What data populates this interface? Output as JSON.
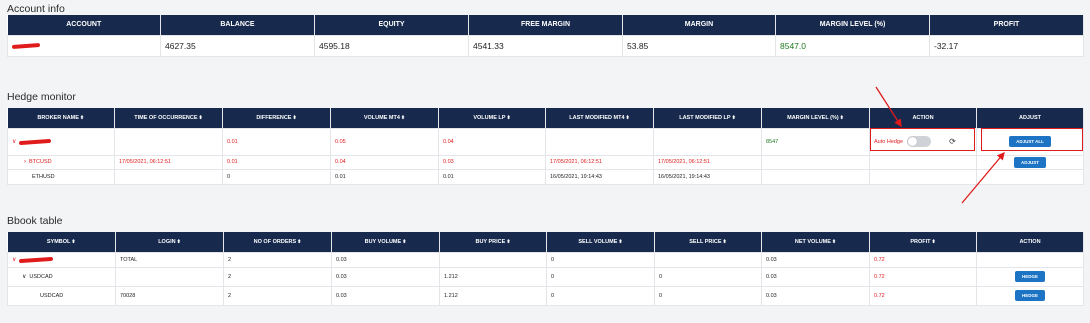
{
  "account": {
    "title": "Account info",
    "headers": [
      "ACCOUNT",
      "BALANCE",
      "EQUITY",
      "FREE MARGIN",
      "MARGIN",
      "MARGIN LEVEL (%)",
      "PROFIT"
    ],
    "row": {
      "balance": "4627.35",
      "equity": "4595.18",
      "free_margin": "4541.33",
      "margin": "53.85",
      "margin_level": "8547.0",
      "profit": "-32.17"
    }
  },
  "hedge": {
    "title": "Hedge monitor",
    "headers": [
      "BROKER NAME",
      "TIME OF OCCURRENCE",
      "DIFFERENCE",
      "VOLUME MT4",
      "VOLUME LP",
      "LAST MODIFIED MT4",
      "LAST MODIFIED LP",
      "MARGIN LEVEL (%)",
      "ACTION",
      "ADJUST"
    ],
    "rows": [
      {
        "name": "",
        "time": "",
        "difference": "0.01",
        "vol_mt4": "0.05",
        "vol_lp": "0.04",
        "mod_mt4": "",
        "mod_lp": "",
        "margin_level": "8547",
        "auto_hedge": "Auto Hedge",
        "adjust": "ADJUST ALL"
      },
      {
        "name": "BTCUSD",
        "time": "17/05/2021, 06:12:51",
        "difference": "0.01",
        "vol_mt4": "0.04",
        "vol_lp": "0.03",
        "mod_mt4": "17/05/2021, 06:12:51",
        "mod_lp": "17/05/2021, 06:12:51",
        "margin_level": "",
        "adjust": "ADJUST"
      },
      {
        "name": "ETHUSD",
        "time": "",
        "difference": "0",
        "vol_mt4": "0.01",
        "vol_lp": "0.01",
        "mod_mt4": "16/05/2021, 19:14:43",
        "mod_lp": "16/05/2021, 19:14:43",
        "margin_level": ""
      }
    ]
  },
  "bbook": {
    "title": "Bbook table",
    "headers": [
      "SYMBOL",
      "LOGIN",
      "NO OF ORDERS",
      "BUY VOLUME",
      "BUY PRICE",
      "SELL VOLUME",
      "SELL PRICE",
      "NET VOLUME",
      "PROFIT",
      "ACTION"
    ],
    "rows": [
      {
        "symbol": "",
        "login": "TOTAL",
        "orders": "2",
        "buy_vol": "0.03",
        "buy_price": "",
        "sell_vol": "0",
        "sell_price": "",
        "net_vol": "0.03",
        "profit": "0.72",
        "action": ""
      },
      {
        "symbol": "USDCAD",
        "login": "",
        "orders": "2",
        "buy_vol": "0.03",
        "buy_price": "1.212",
        "sell_vol": "0",
        "sell_price": "0",
        "net_vol": "0.03",
        "profit": "0.72",
        "action": "HEDGE"
      },
      {
        "symbol": "USDCAD",
        "login": "70028",
        "orders": "2",
        "buy_vol": "0.03",
        "buy_price": "1.212",
        "sell_vol": "0",
        "sell_price": "0",
        "net_vol": "0.03",
        "profit": "0.72",
        "action": "HEDGE"
      }
    ]
  },
  "icons": {
    "sort": "sort-arrows-icon",
    "expand": "chevron-icon",
    "refresh": "refresh-icon"
  },
  "colors": {
    "header_bg": "#17294d",
    "negative": "#e01b1b",
    "positive": "#1f7a1f",
    "button": "#1d74c4"
  }
}
